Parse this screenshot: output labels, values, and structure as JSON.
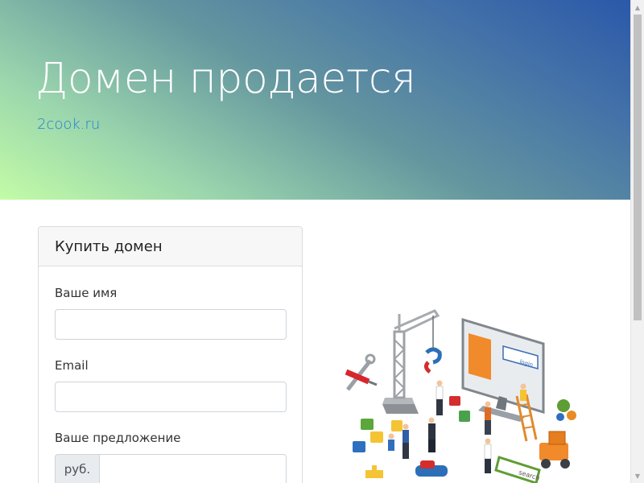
{
  "hero": {
    "title": "Домен продается",
    "domain": "2cook.ru"
  },
  "form": {
    "title": "Купить домен",
    "name_label": "Ваше имя",
    "email_label": "Email",
    "offer_label": "Ваше предложение",
    "currency": "руб.",
    "name_value": "",
    "email_value": "",
    "offer_value": ""
  },
  "illustration": {
    "screen_text": "login",
    "tag_text": "search"
  },
  "colors": {
    "hero_gradient_start": "#c3fca6",
    "hero_gradient_end": "#2b58a9",
    "link": "#1f7fd6"
  }
}
